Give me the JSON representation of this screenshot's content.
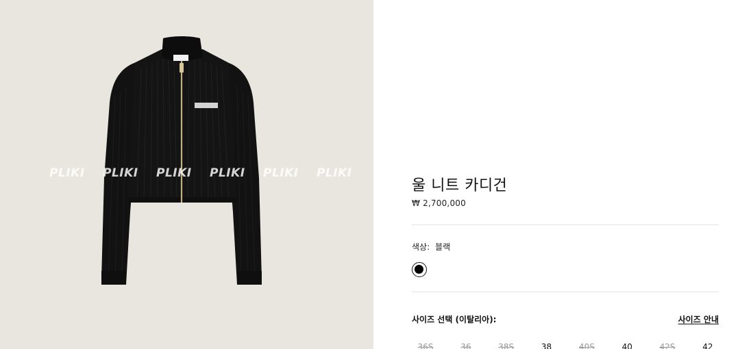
{
  "gallery": {
    "watermarks": [
      "PLIKI",
      "PLIKI",
      "PLIKI",
      "PLIKI",
      "PLIKI",
      "PLIKI"
    ],
    "chest_logo": "MIU MIU",
    "neck_label": "MIU MIU"
  },
  "product": {
    "title": "울 니트 카디건",
    "price": "₩ 2,700,000"
  },
  "color": {
    "label": "색상:",
    "value": "블랙",
    "swatch_hex": "#000000"
  },
  "size": {
    "label": "사이즈 선택 (이탈리아):",
    "guide_label": "사이즈 안내",
    "options": [
      {
        "label": "36S",
        "available": false
      },
      {
        "label": "36",
        "available": false
      },
      {
        "label": "38S",
        "available": false
      },
      {
        "label": "38",
        "available": true
      },
      {
        "label": "40S",
        "available": false
      },
      {
        "label": "40",
        "available": true
      },
      {
        "label": "42S",
        "available": false
      },
      {
        "label": "42",
        "available": true
      }
    ]
  }
}
